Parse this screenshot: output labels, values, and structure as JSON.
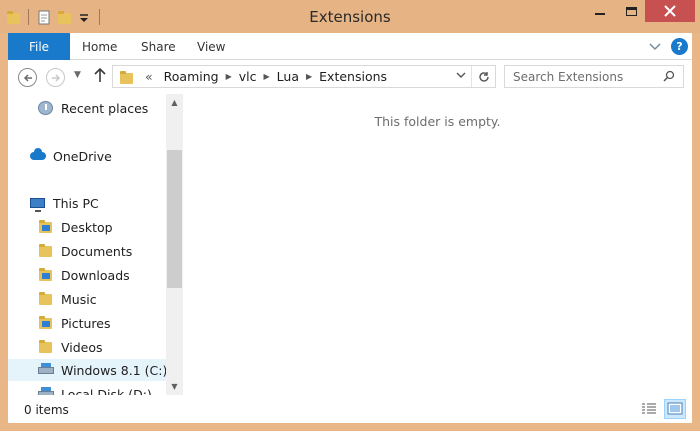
{
  "window": {
    "title": "Extensions",
    "colors": {
      "frame": "#e6b385",
      "accent": "#1979ca",
      "close": "#c75050"
    }
  },
  "titlebar": {
    "qat_icons": [
      "folder-icon",
      "properties-icon",
      "new-folder-icon",
      "customize-qat-icon"
    ],
    "controls": [
      "minimize-icon",
      "maximize-icon",
      "close-icon"
    ]
  },
  "ribbon": {
    "file_label": "File",
    "tabs": [
      {
        "label": "Home"
      },
      {
        "label": "Share"
      },
      {
        "label": "View"
      }
    ]
  },
  "navigation": {
    "address": {
      "overflow": "«",
      "crumbs": [
        "Roaming",
        "vlc",
        "Lua",
        "Extensions"
      ]
    },
    "search": {
      "placeholder": "Search Extensions"
    }
  },
  "navpane": {
    "items": [
      {
        "label": "Recent places",
        "icon": "recent-places-icon"
      },
      {
        "label": "OneDrive",
        "icon": "onedrive-icon"
      },
      {
        "label": "This PC",
        "icon": "this-pc-icon"
      },
      {
        "label": "Desktop",
        "icon": "desktop-folder-icon"
      },
      {
        "label": "Documents",
        "icon": "documents-folder-icon"
      },
      {
        "label": "Downloads",
        "icon": "downloads-folder-icon"
      },
      {
        "label": "Music",
        "icon": "music-folder-icon"
      },
      {
        "label": "Pictures",
        "icon": "pictures-folder-icon"
      },
      {
        "label": "Videos",
        "icon": "videos-folder-icon"
      },
      {
        "label": "Windows 8.1 (C:)",
        "icon": "drive-icon",
        "selected": true
      },
      {
        "label": "Local Disk (D:)",
        "icon": "drive-icon"
      }
    ]
  },
  "main": {
    "empty_message": "This folder is empty."
  },
  "statusbar": {
    "item_count": "0 items",
    "view_modes": [
      "details-view-icon",
      "large-icons-view-icon"
    ]
  }
}
